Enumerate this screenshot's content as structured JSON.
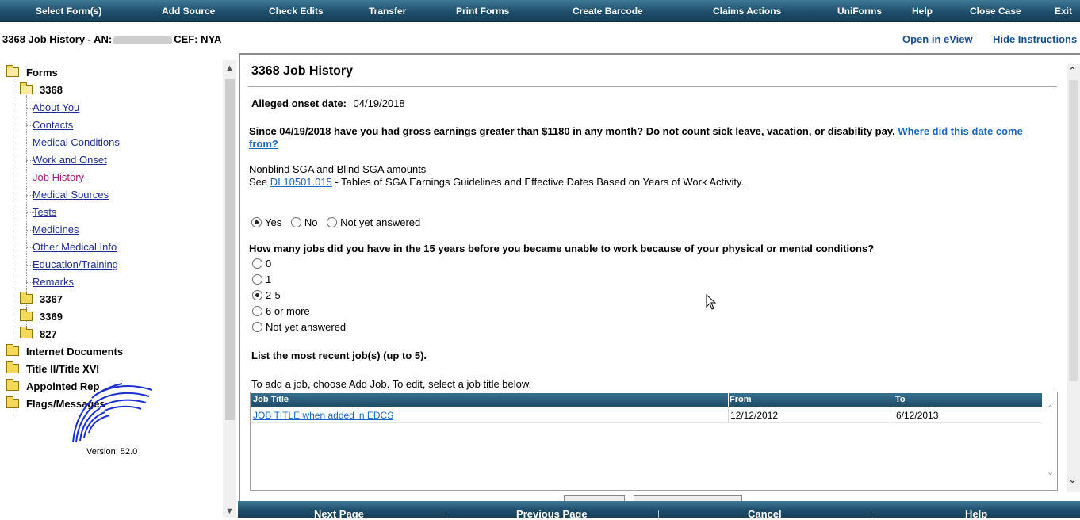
{
  "menu": [
    "Select Form(s)",
    "Add Source",
    "Check Edits",
    "Transfer",
    "Print Forms",
    "Create Barcode",
    "Claims Actions",
    "UniForms",
    "Help",
    "Close Case",
    "Exit"
  ],
  "header": {
    "title_prefix": "3368 Job History - AN:",
    "title_suffix": "CEF: NYA",
    "open_eview": "Open in eView",
    "hide_instructions": "Hide Instructions"
  },
  "tree": {
    "forms": "Forms",
    "form_3368": "3368",
    "pages": [
      "About You",
      "Contacts",
      "Medical Conditions",
      "Work and Onset",
      "Job History",
      "Medical Sources",
      "Tests",
      "Medicines",
      "Other Medical Info",
      "Education/Training",
      "Remarks"
    ],
    "active_page": "Job History",
    "form_3367": "3367",
    "form_3369": "3369",
    "form_827": "827",
    "internet_documents": "Internet Documents",
    "title_ii_xvi": "Title II/Title XVI",
    "appointed_rep": "Appointed Rep",
    "flags_messages": "Flags/Messages"
  },
  "version": "Version: 52.0",
  "form": {
    "title": "3368 Job History",
    "onset_label": "Alleged onset date:",
    "onset_value": "04/19/2018",
    "question1": "Since 04/19/2018 have you had gross earnings greater than $1180 in any month? Do not count sick leave, vacation, or disability pay.",
    "question1_link_a": "Where did this date come",
    "question1_link_b": "from?",
    "sga_title": "Nonblind SGA and Blind SGA amounts",
    "sga_see": "See",
    "sga_link": "DI 10501.015",
    "sga_rest": "- Tables of SGA Earnings Guidelines and Effective Dates Based on Years of Work Activity.",
    "q1_options": [
      "Yes",
      "No",
      "Not yet answered"
    ],
    "q1_selected": "Yes",
    "question2": "How many jobs did you have in the 15 years before you became unable to work because of your physical or mental conditions?",
    "q2_options": [
      "0",
      "1",
      "2-5",
      "6 or more",
      "Not yet answered"
    ],
    "q2_selected": "2-5",
    "list_heading": "List the most recent job(s) (up to 5).",
    "list_instructions": "To add a job, choose Add Job. To edit, select a job title below.",
    "table": {
      "columns": [
        "Job Title",
        "From",
        "To"
      ],
      "rows": [
        [
          "JOB TITLE when added in EDCS",
          "12/12/2012",
          "6/12/2013"
        ]
      ]
    }
  },
  "bottom": [
    "Next Page",
    "Previous Page",
    "Cancel",
    "Help"
  ],
  "colors": {
    "bar": "#1e4f6c",
    "link": "#1a68c0",
    "active_link": "#a0207a",
    "tree_link": "#1d2f93"
  }
}
